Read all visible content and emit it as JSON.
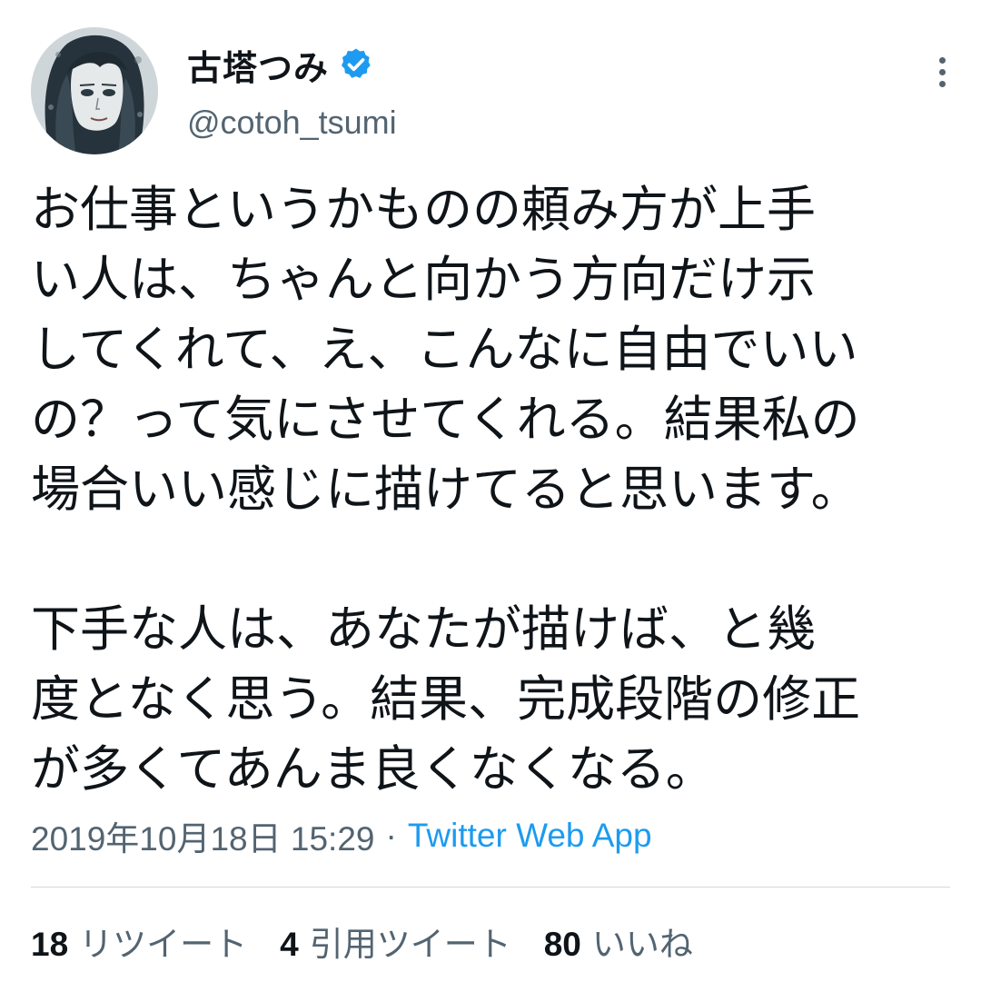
{
  "user": {
    "display_name": "古塔つみ",
    "handle": "@cotoh_tsumi",
    "verified": true,
    "avatar_icon": "avatar-illustration"
  },
  "menu_icon": "more-options-icon",
  "tweet": {
    "lines_para1": [
      "お仕事というかものの頼み方が上手",
      "い人は、ちゃんと向かう方向だけ示",
      "してくれて、え、こんなに自由でいい",
      "の？って気にさせてくれる。結果私の",
      "場合いい感じに描けてると思います。"
    ],
    "lines_para2": [
      "下手な人は、あなたが描けば、と幾",
      "度となく思う。結果、完成段階の修正",
      "が多くてあんま良くなくなる。"
    ]
  },
  "meta": {
    "timestamp": "2019年10月18日 15:29",
    "separator": "·",
    "source": "Twitter Web App"
  },
  "stats": {
    "retweets_count": "18",
    "retweets_label": "リツイート",
    "quotes_count": "4",
    "quotes_label": "引用ツイート",
    "likes_count": "80",
    "likes_label": "いいね"
  },
  "colors": {
    "text": "#0f1419",
    "secondary": "#536471",
    "link": "#1d9bf0",
    "divider": "#cfd9de",
    "verified": "#1d9bf0"
  }
}
